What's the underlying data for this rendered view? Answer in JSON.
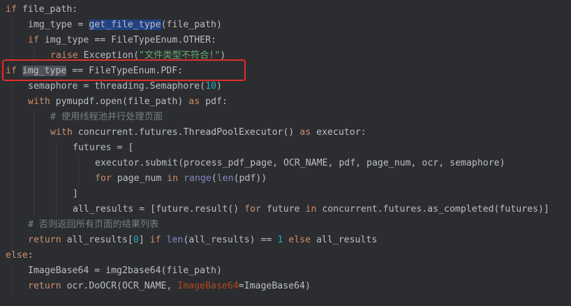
{
  "code_lines": [
    {
      "indent": 0,
      "tokens": [
        {
          "t": "if",
          "k": "keyword"
        },
        {
          "t": " file_path:",
          "k": "plain"
        }
      ]
    },
    {
      "indent": 1,
      "tokens": [
        {
          "t": "img_type = ",
          "k": "plain"
        },
        {
          "t": "get_file_type",
          "k": "sel"
        },
        {
          "t": "(file_path)",
          "k": "plain"
        }
      ]
    },
    {
      "indent": 1,
      "tokens": [
        {
          "t": "if",
          "k": "keyword"
        },
        {
          "t": " img_type == FileTypeEnum.OTHER:",
          "k": "plain"
        }
      ]
    },
    {
      "indent": 2,
      "tokens": [
        {
          "t": "raise",
          "k": "keyword"
        },
        {
          "t": " Exception(",
          "k": "plain"
        },
        {
          "t": "\"文件类型不符合!\"",
          "k": "string"
        },
        {
          "t": ")",
          "k": "plain"
        }
      ]
    },
    {
      "indent": 0,
      "tokens": [
        {
          "t": "if",
          "k": "keyword"
        },
        {
          "t": " ",
          "k": "plain"
        },
        {
          "t": "img_type",
          "k": "usage"
        },
        {
          "t": " == FileTypeEnum.PDF:",
          "k": "plain"
        }
      ]
    },
    {
      "indent": 1,
      "tokens": [
        {
          "t": "semaphore = threading.Semaphore(",
          "k": "plain"
        },
        {
          "t": "10",
          "k": "number"
        },
        {
          "t": ")",
          "k": "plain"
        }
      ]
    },
    {
      "indent": 1,
      "tokens": [
        {
          "t": "with",
          "k": "keyword"
        },
        {
          "t": " pymupdf.open(file_path) ",
          "k": "plain"
        },
        {
          "t": "as",
          "k": "keyword"
        },
        {
          "t": " pdf:",
          "k": "plain"
        }
      ]
    },
    {
      "indent": 2,
      "tokens": [
        {
          "t": "# 使用线程池并行处理页面",
          "k": "comment"
        }
      ]
    },
    {
      "indent": 2,
      "tokens": [
        {
          "t": "with",
          "k": "keyword"
        },
        {
          "t": " concurrent.futures.ThreadPoolExecutor() ",
          "k": "plain"
        },
        {
          "t": "as",
          "k": "keyword"
        },
        {
          "t": " executor:",
          "k": "plain"
        }
      ]
    },
    {
      "indent": 3,
      "tokens": [
        {
          "t": "futures = [",
          "k": "plain"
        }
      ]
    },
    {
      "indent": 4,
      "tokens": [
        {
          "t": "executor.submit(process_pdf_page, OCR_NAME, pdf, page_num, ocr, semaphore)",
          "k": "plain"
        }
      ]
    },
    {
      "indent": 4,
      "tokens": [
        {
          "t": "for",
          "k": "keyword"
        },
        {
          "t": " page_num ",
          "k": "plain"
        },
        {
          "t": "in",
          "k": "keyword"
        },
        {
          "t": " ",
          "k": "plain"
        },
        {
          "t": "range",
          "k": "builtin"
        },
        {
          "t": "(",
          "k": "plain"
        },
        {
          "t": "len",
          "k": "builtin"
        },
        {
          "t": "(pdf))",
          "k": "plain"
        }
      ]
    },
    {
      "indent": 3,
      "tokens": [
        {
          "t": "]",
          "k": "plain"
        }
      ]
    },
    {
      "indent": 3,
      "tokens": [
        {
          "t": "all_results = [future.result() ",
          "k": "plain"
        },
        {
          "t": "for",
          "k": "keyword"
        },
        {
          "t": " future ",
          "k": "plain"
        },
        {
          "t": "in",
          "k": "keyword"
        },
        {
          "t": " concurrent.futures.as_completed(futures)]",
          "k": "plain"
        }
      ]
    },
    {
      "indent": 1,
      "tokens": [
        {
          "t": "# 否则返回所有页面的结果列表",
          "k": "comment"
        }
      ]
    },
    {
      "indent": 1,
      "tokens": [
        {
          "t": "return",
          "k": "keyword"
        },
        {
          "t": " all_results[",
          "k": "plain"
        },
        {
          "t": "0",
          "k": "number"
        },
        {
          "t": "] ",
          "k": "plain"
        },
        {
          "t": "if",
          "k": "keyword"
        },
        {
          "t": " ",
          "k": "plain"
        },
        {
          "t": "len",
          "k": "builtin"
        },
        {
          "t": "(all_results) == ",
          "k": "plain"
        },
        {
          "t": "1",
          "k": "number"
        },
        {
          "t": " ",
          "k": "plain"
        },
        {
          "t": "else",
          "k": "keyword"
        },
        {
          "t": " all_results",
          "k": "plain"
        }
      ]
    },
    {
      "indent": 0,
      "tokens": [
        {
          "t": "else",
          "k": "keyword"
        },
        {
          "t": ":",
          "k": "plain"
        }
      ]
    },
    {
      "indent": 1,
      "tokens": [
        {
          "t": "ImageBase64 = img2base64(file_path)",
          "k": "plain"
        }
      ]
    },
    {
      "indent": 1,
      "tokens": [
        {
          "t": "return",
          "k": "keyword"
        },
        {
          "t": " ocr.DoOCR(OCR_NAME, ",
          "k": "plain"
        },
        {
          "t": "ImageBase64",
          "k": "param"
        },
        {
          "t": "=ImageBase64)",
          "k": "plain"
        }
      ]
    }
  ],
  "colors": {
    "background": "#2b2d30",
    "keyword": "#cf8e6d",
    "text": "#bcbec4",
    "number": "#2aacb8",
    "string": "#6aab73",
    "comment": "#7a7e85",
    "builtin": "#8888c6",
    "param": "#aa4926",
    "selection": "#214283",
    "usage_highlight": "#4e5157",
    "annotation_box": "#e02d2d"
  }
}
